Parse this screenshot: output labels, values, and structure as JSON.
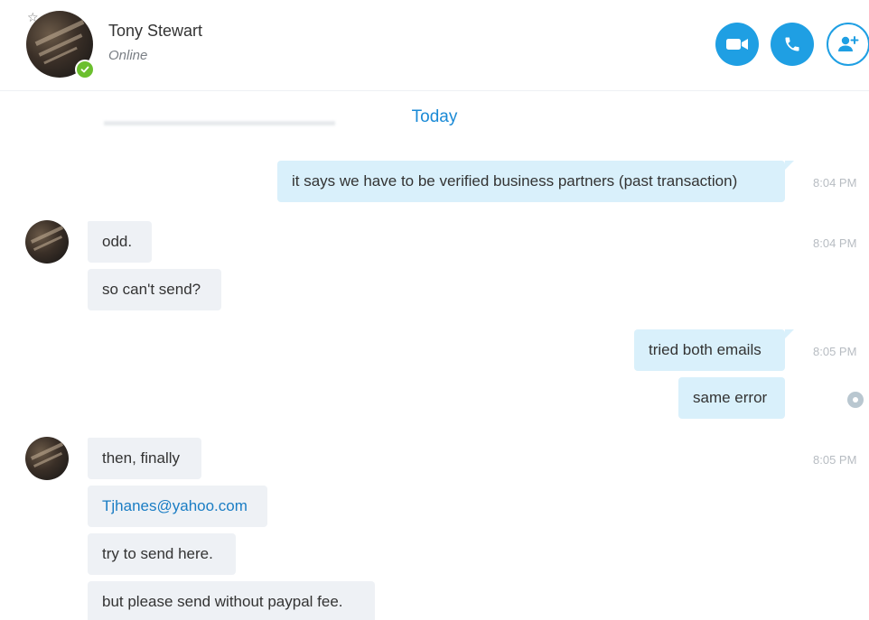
{
  "contact": {
    "name": "Tony Stewart",
    "status": "Online"
  },
  "header_actions": [
    {
      "name": "video-call-button",
      "icon": "video-camera-icon"
    },
    {
      "name": "audio-call-button",
      "icon": "phone-icon"
    },
    {
      "name": "add-people-button",
      "icon": "add-person-icon"
    }
  ],
  "colors": {
    "accent": "#1f9fe3",
    "outgoing_bubble": "#d9f0fb",
    "incoming_bubble": "#eef1f5",
    "presence_online": "#6bbf2e",
    "link": "#1a7dc4"
  },
  "divider": {
    "label": "Today"
  },
  "messages": [
    {
      "direction": "out",
      "text": "it says we have to be verified business partners (past transaction)",
      "time": "8:04 PM"
    },
    {
      "direction": "in",
      "text": "odd.",
      "time": "8:04 PM"
    },
    {
      "direction": "in",
      "text": "so can't send?",
      "time": ""
    },
    {
      "direction": "out",
      "text": "tried both emails",
      "time": "8:05 PM"
    },
    {
      "direction": "out",
      "text": "same error",
      "time": ""
    },
    {
      "direction": "in",
      "text": "then, finally",
      "time": "8:05 PM"
    },
    {
      "direction": "in",
      "text": "Tjhanes@yahoo.com",
      "time": ""
    },
    {
      "direction": "in",
      "text": "try to send here.",
      "time": ""
    },
    {
      "direction": "in",
      "text": "but please send without paypal fee.",
      "time": ""
    }
  ]
}
